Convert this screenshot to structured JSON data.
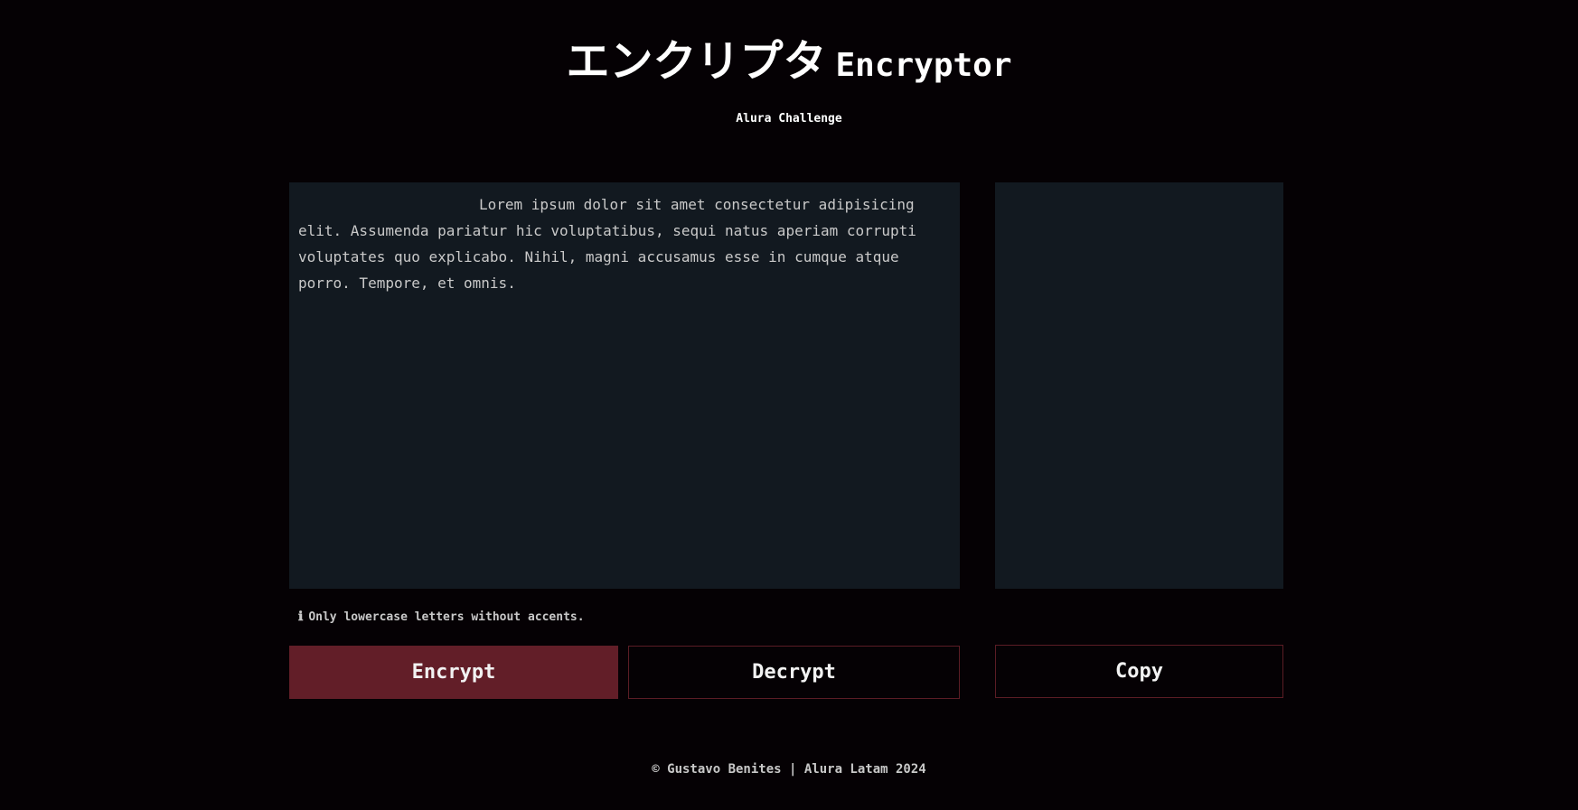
{
  "header": {
    "title_jp": "エンクリプタ",
    "title_en": "Encryptor",
    "subtitle": "Alura Challenge"
  },
  "input": {
    "value": "Lorem ipsum dolor sit amet consectetur adipisicing elit. Assumenda pariatur hic voluptatibus, sequi natus aperiam corrupti voluptates quo explicabo. Nihil, magni accusamus esse in cumque atque porro. Tempore, et omnis."
  },
  "output": {
    "value": ""
  },
  "hint": {
    "icon": "info-icon",
    "icon_glyph": "ℹ",
    "text": "Only lowercase letters without accents."
  },
  "buttons": {
    "encrypt_label": "Encrypt",
    "decrypt_label": "Decrypt",
    "copy_label": "Copy"
  },
  "footer": {
    "text": "© Gustavo Benites | Alura Latam 2024"
  },
  "colors": {
    "background": "#050104",
    "panel": "#121920",
    "accent": "#621e28"
  }
}
